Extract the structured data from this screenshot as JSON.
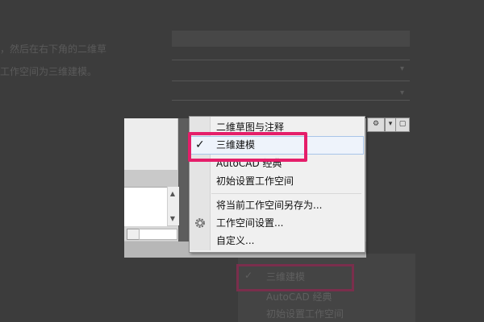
{
  "background": {
    "text_line1": "，然后在右下角的二维草",
    "text_line2": "工作空间为三维建模。",
    "menu_echo_items": [
      "三维建模",
      "AutoCAD 经典",
      "初始设置工作空间"
    ],
    "caret_glyph": "▾"
  },
  "menu": {
    "items": [
      {
        "label": "二维草图与注释",
        "checked": false
      },
      {
        "label": "三维建模",
        "checked": true
      },
      {
        "label": "AutoCAD 经典",
        "checked": false
      },
      {
        "label": "初始设置工作空间",
        "checked": false
      }
    ],
    "actions": [
      {
        "label": "将当前工作空间另存为..."
      },
      {
        "label": "工作空间设置..."
      },
      {
        "label": "自定义..."
      }
    ],
    "checkmark_glyph": "✓",
    "icon": "gear-icon"
  },
  "scrollbar": {
    "up_glyph": "▲",
    "down_glyph": "▼"
  },
  "colors": {
    "highlight": "#e51e6a",
    "dim_highlight": "#7a2e4c",
    "menu_bg": "#f0f0f0"
  }
}
